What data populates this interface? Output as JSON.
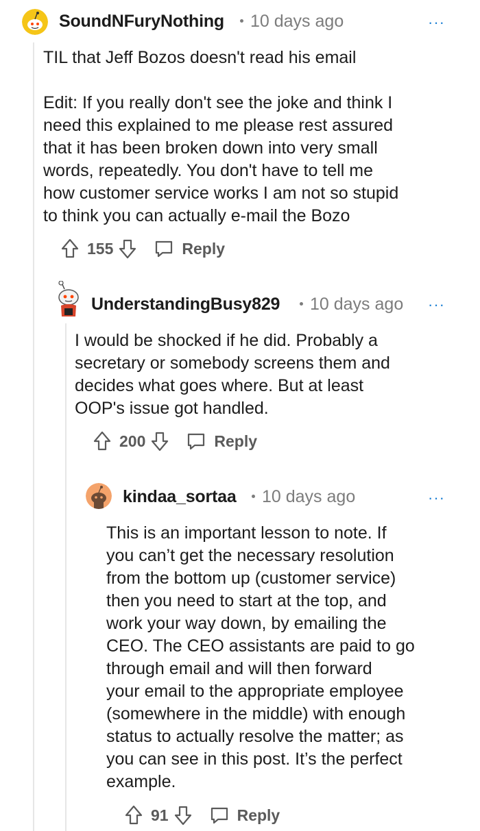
{
  "comments": [
    {
      "username": "SoundNFuryNothing",
      "time": "10 days ago",
      "body": "TIL that Jeff Bozos doesn't read his email\n\nEdit: If you really don't see the joke and think I\nneed this explained to me please rest assured\nthat it has been broken down into very small\nwords, repeatedly. You don't have to tell me\nhow customer service works I am not so stupid\nto think you can actually e-mail the Bozo",
      "score": "155",
      "reply": "Reply",
      "more": "···",
      "avatar_color": "#f5c518"
    },
    {
      "username": "UnderstandingBusy829",
      "time": "10 days ago",
      "body": "I would be shocked if he did. Probably a\nsecretary or somebody screens them and\ndecides what goes where. But at least\nOOP's issue got handled.",
      "score": "200",
      "reply": "Reply",
      "more": "···",
      "avatar_color": "#e8e8e8"
    },
    {
      "username": "kindaa_sortaa",
      "time": "10 days ago",
      "body": "This is an important lesson to note. If\nyou can’t get the necessary resolution\nfrom the bottom up (customer service)\nthen you need to start at the top, and\nwork your way down, by emailing the\nCEO. The CEO assistants are paid to go\nthrough email and will then forward\nyour email to the appropriate employee\n(somewhere in the middle) with enough\nstatus to actually resolve the matter; as\nyou can see in this post. It’s the perfect\nexample.",
      "score": "91",
      "reply": "Reply",
      "more": "···",
      "avatar_color": "#f4a36b"
    }
  ]
}
